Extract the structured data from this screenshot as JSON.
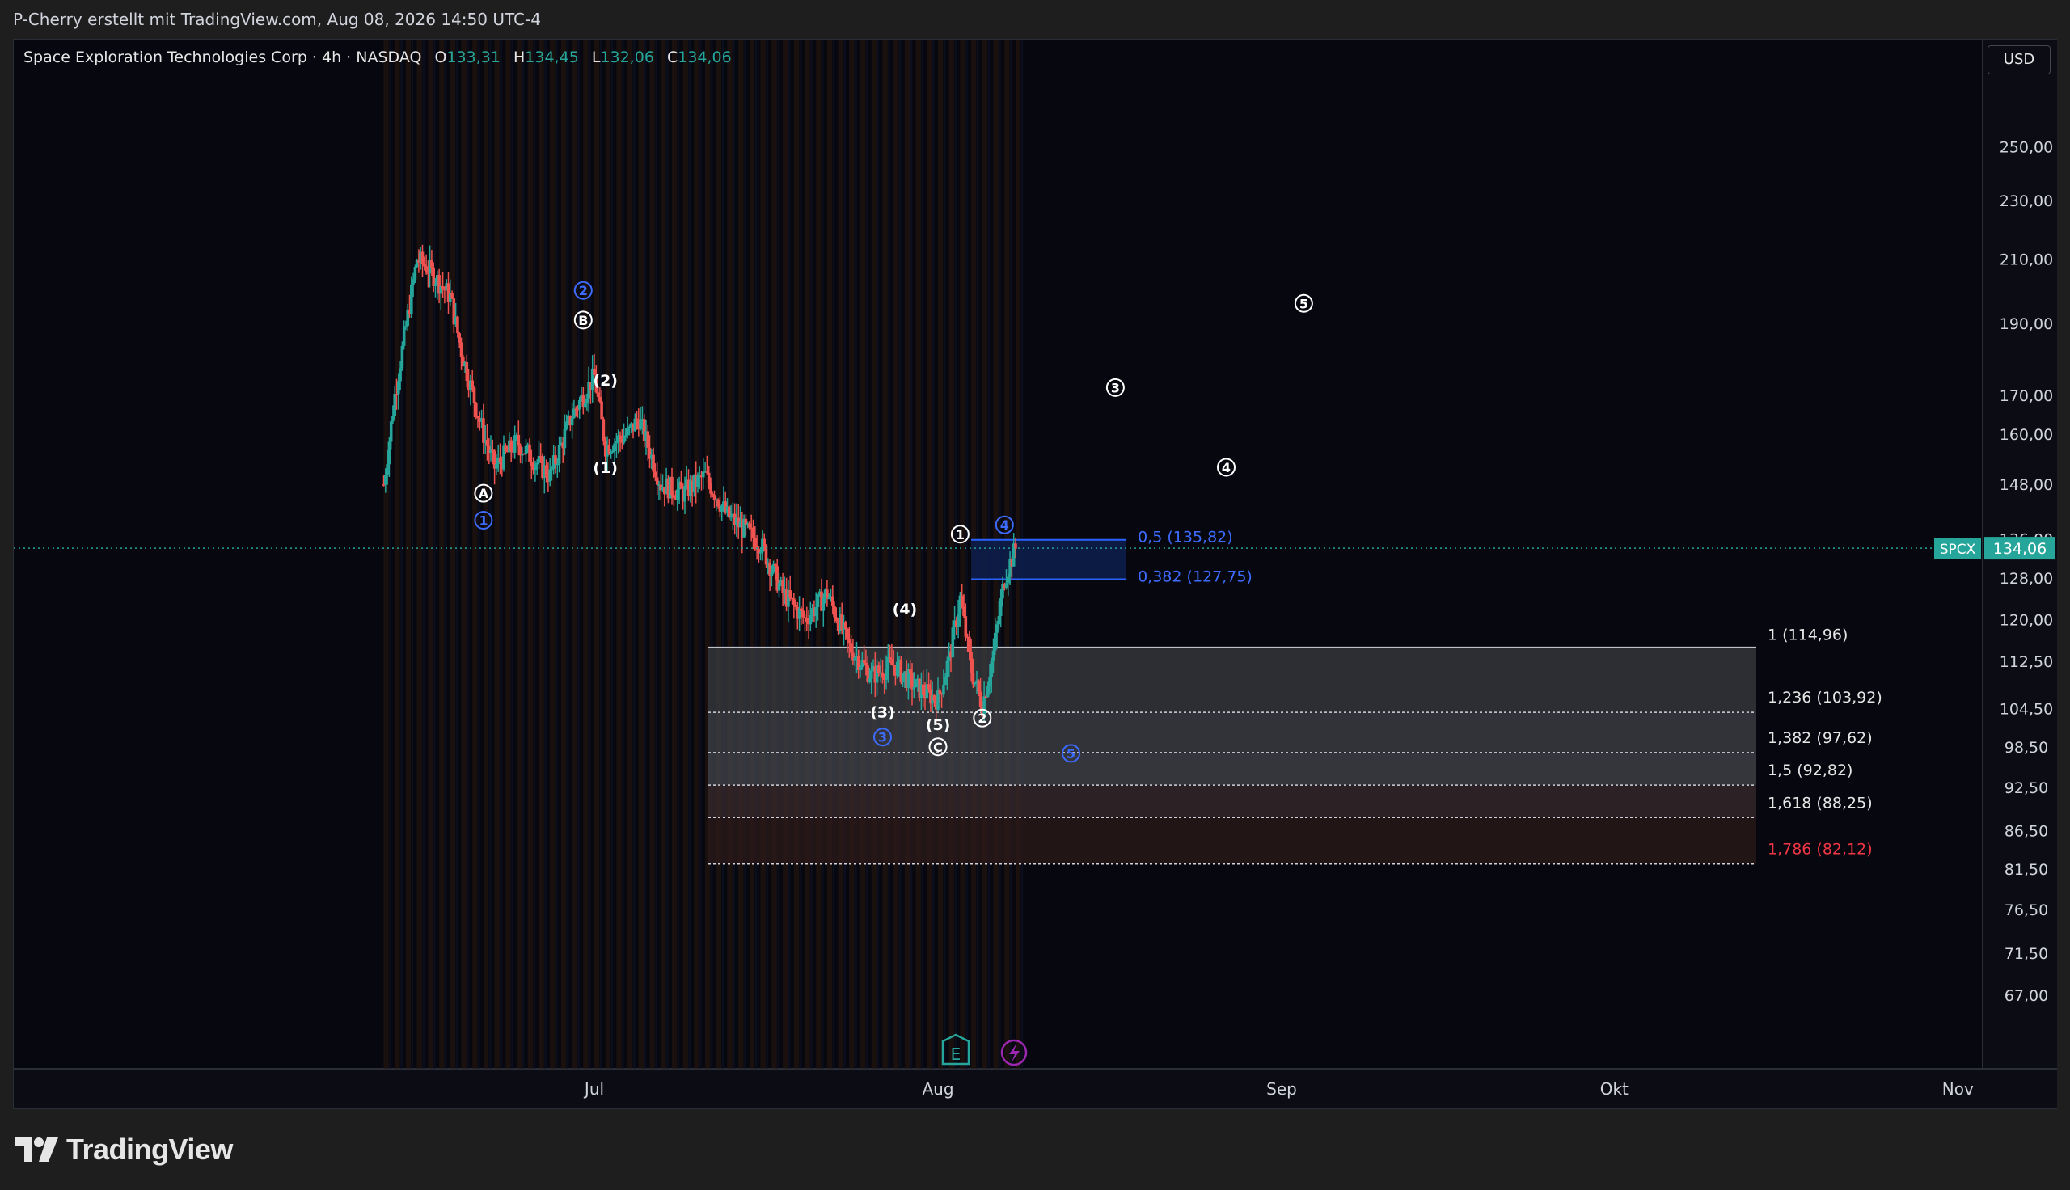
{
  "attribution": "P-Cherry erstellt mit TradingView.com, Aug 08, 2026 14:50 UTC-4",
  "legend": {
    "title": "Space Exploration Technologies Corp · 4h · NASDAQ",
    "o_label": "O",
    "o": "133,31",
    "h_label": "H",
    "h": "134,45",
    "l_label": "L",
    "l": "132,06",
    "c_label": "C",
    "c": "134,06"
  },
  "currency": "USD",
  "brand": "TradingView",
  "colors": {
    "up": "#26a69a",
    "down": "#ef5350",
    "blue": "#2962ff",
    "zone_grey": "#4a4d55",
    "zone_red": "#6b2a2a",
    "fib_red": "#f23645"
  },
  "icons": [
    "earnings-e-icon",
    "dividend-lightning-icon",
    "tradingview-logo-icon"
  ],
  "chart_data": {
    "type": "candlestick",
    "symbol": "SPCX",
    "interval": "4h",
    "exchange": "NASDAQ",
    "last_price": 134.06,
    "last_price_label": "134,06",
    "y_scale": "log",
    "ylim": [
      63,
      270
    ],
    "y_ticks": [
      "250,00",
      "230,00",
      "210,00",
      "190,00",
      "170,00",
      "160,00",
      "148,00",
      "136,00",
      "128,00",
      "120,00",
      "112,50",
      "104,50",
      "98,50",
      "92,50",
      "86,50",
      "81,50",
      "76,50",
      "71,50",
      "67,00"
    ],
    "x_ticks": [
      "Jul",
      "Aug",
      "Sep",
      "Okt",
      "Nov"
    ],
    "x_tick_dates": [
      "2026-07-01",
      "2026-08-01",
      "2026-09-01",
      "2026-10-01",
      "2026-11-01"
    ],
    "price_path": [
      {
        "date": "2026-06-12",
        "price": 148
      },
      {
        "date": "2026-06-13",
        "price": 170
      },
      {
        "date": "2026-06-15",
        "price": 210
      },
      {
        "date": "2026-06-16",
        "price": 207
      },
      {
        "date": "2026-06-18",
        "price": 198
      },
      {
        "date": "2026-06-19",
        "price": 182
      },
      {
        "date": "2026-06-21",
        "price": 160
      },
      {
        "date": "2026-06-22",
        "price": 152
      },
      {
        "date": "2026-06-24",
        "price": 158
      },
      {
        "date": "2026-06-27",
        "price": 150
      },
      {
        "date": "2026-06-29",
        "price": 165
      },
      {
        "date": "2026-07-01",
        "price": 175
      },
      {
        "date": "2026-07-02",
        "price": 157
      },
      {
        "date": "2026-07-04",
        "price": 160
      },
      {
        "date": "2026-07-05",
        "price": 164
      },
      {
        "date": "2026-07-07",
        "price": 148
      },
      {
        "date": "2026-07-09",
        "price": 146
      },
      {
        "date": "2026-07-11",
        "price": 150
      },
      {
        "date": "2026-07-13",
        "price": 141
      },
      {
        "date": "2026-07-16",
        "price": 135
      },
      {
        "date": "2026-07-18",
        "price": 125
      },
      {
        "date": "2026-07-20",
        "price": 120
      },
      {
        "date": "2026-07-22",
        "price": 125
      },
      {
        "date": "2026-07-24",
        "price": 115
      },
      {
        "date": "2026-07-26",
        "price": 110
      },
      {
        "date": "2026-07-28",
        "price": 112
      },
      {
        "date": "2026-07-30",
        "price": 108
      },
      {
        "date": "2026-08-01",
        "price": 106
      },
      {
        "date": "2026-08-02",
        "price": 113
      },
      {
        "date": "2026-08-03",
        "price": 124
      },
      {
        "date": "2026-08-04",
        "price": 111
      },
      {
        "date": "2026-08-05",
        "price": 105
      },
      {
        "date": "2026-08-06",
        "price": 114
      },
      {
        "date": "2026-08-07",
        "price": 128
      },
      {
        "date": "2026-08-08",
        "price": 134.06
      }
    ],
    "fib_extension": [
      {
        "label": "1 (114,96)",
        "value": 114.96,
        "color": "#e6e6e6"
      },
      {
        "label": "1,236 (103,92)",
        "value": 103.92,
        "color": "#e6e6e6"
      },
      {
        "label": "1,382 (97,62)",
        "value": 97.62,
        "color": "#e6e6e6"
      },
      {
        "label": "1,5 (92,82)",
        "value": 92.82,
        "color": "#e6e6e6"
      },
      {
        "label": "1,618 (88,25)",
        "value": 88.25,
        "color": "#e6e6e6"
      },
      {
        "label": "1,786 (82,12)",
        "value": 82.12,
        "color": "#f23645"
      }
    ],
    "fib_retracement": [
      {
        "label": "0,5 (135,82)",
        "value": 135.82
      },
      {
        "label": "0,382 (127,75)",
        "value": 127.75
      }
    ],
    "wave_labels": [
      {
        "text": "1",
        "style": "circle-blue",
        "date": "2026-06-21",
        "price": 140
      },
      {
        "text": "A",
        "style": "circle-white",
        "date": "2026-06-21",
        "price": 146
      },
      {
        "text": "2",
        "style": "circle-blue",
        "date": "2026-06-30",
        "price": 200
      },
      {
        "text": "B",
        "style": "circle-white",
        "date": "2026-06-30",
        "price": 191
      },
      {
        "text": "(2)",
        "style": "plain",
        "date": "2026-07-02",
        "price": 174
      },
      {
        "text": "(1)",
        "style": "plain",
        "date": "2026-07-02",
        "price": 152
      },
      {
        "text": "(4)",
        "style": "plain",
        "date": "2026-07-29",
        "price": 122
      },
      {
        "text": "(3)",
        "style": "plain",
        "date": "2026-07-27",
        "price": 104
      },
      {
        "text": "3",
        "style": "circle-blue",
        "date": "2026-07-27",
        "price": 100
      },
      {
        "text": "(5)",
        "style": "plain",
        "date": "2026-08-01",
        "price": 102
      },
      {
        "text": "C",
        "style": "circle-white",
        "date": "2026-08-01",
        "price": 98.5
      },
      {
        "text": "1",
        "style": "circle-white",
        "date": "2026-08-03",
        "price": 137
      },
      {
        "text": "2",
        "style": "circle-white",
        "date": "2026-08-05",
        "price": 103
      },
      {
        "text": "4",
        "style": "circle-blue",
        "date": "2026-08-07",
        "price": 139
      },
      {
        "text": "5",
        "style": "circle-blue",
        "date": "2026-08-13",
        "price": 97.5
      },
      {
        "text": "3",
        "style": "circle-white",
        "date": "2026-08-17",
        "price": 172
      },
      {
        "text": "4",
        "style": "circle-white",
        "date": "2026-08-27",
        "price": 152
      },
      {
        "text": "5",
        "style": "circle-white",
        "date": "2026-09-03",
        "price": 196
      }
    ]
  }
}
